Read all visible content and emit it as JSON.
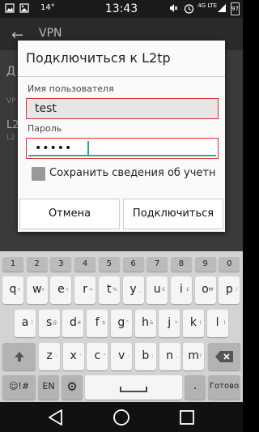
{
  "status_bar": {
    "time": "13:43",
    "temperature": "14°",
    "network": "4G LTE",
    "battery": "97"
  },
  "app_bar": {
    "title": "VPN",
    "back_icon": "arrow-left-icon"
  },
  "background_fragments": {
    "item_partial": "Д",
    "section_partial": "VP",
    "entry_partial": "L2",
    "entry_sub_partial": "L2"
  },
  "dialog": {
    "title": "Подключиться к L2tp",
    "username_label": "Имя пользователя",
    "username_value": "test",
    "password_label": "Пароль",
    "password_value": "•••••",
    "save_label": "Сохранить сведения об учетн",
    "cancel_label": "Отмена",
    "connect_label": "Подключиться"
  },
  "keyboard": {
    "numbers": [
      "1",
      "2",
      "3",
      "4",
      "5",
      "6",
      "7",
      "8",
      "9",
      "0"
    ],
    "row1": [
      {
        "key": "q",
        "hint": "+"
      },
      {
        "key": "w",
        "hint": "×"
      },
      {
        "key": "e",
        "hint": "÷"
      },
      {
        "key": "r",
        "hint": "="
      },
      {
        "key": "t",
        "hint": "%"
      },
      {
        "key": "y",
        "hint": "_"
      },
      {
        "key": "u",
        "hint": "€"
      },
      {
        "key": "i",
        "hint": "£"
      },
      {
        "key": "o",
        "hint": "₩"
      },
      {
        "key": "p",
        "hint": "/"
      }
    ],
    "row2": [
      {
        "key": "a",
        "hint": "!"
      },
      {
        "key": "s",
        "hint": "@"
      },
      {
        "key": "d",
        "hint": "#"
      },
      {
        "key": "f",
        "hint": "$"
      },
      {
        "key": "g",
        "hint": "^"
      },
      {
        "key": "h",
        "hint": "&"
      },
      {
        "key": "j",
        "hint": "*"
      },
      {
        "key": "k",
        "hint": "("
      },
      {
        "key": "l",
        "hint": ")"
      }
    ],
    "row3": [
      {
        "key": "z",
        "hint": "-"
      },
      {
        "key": "x",
        "hint": "'"
      },
      {
        "key": "c",
        "hint": "\""
      },
      {
        "key": "v",
        "hint": ":"
      },
      {
        "key": "b",
        "hint": ";"
      },
      {
        "key": "n",
        "hint": ","
      },
      {
        "key": "m",
        "hint": "?"
      }
    ],
    "symbols_label": "☺!#",
    "lang_label": "EN",
    "period_label": ".",
    "done_label": "Готово"
  }
}
